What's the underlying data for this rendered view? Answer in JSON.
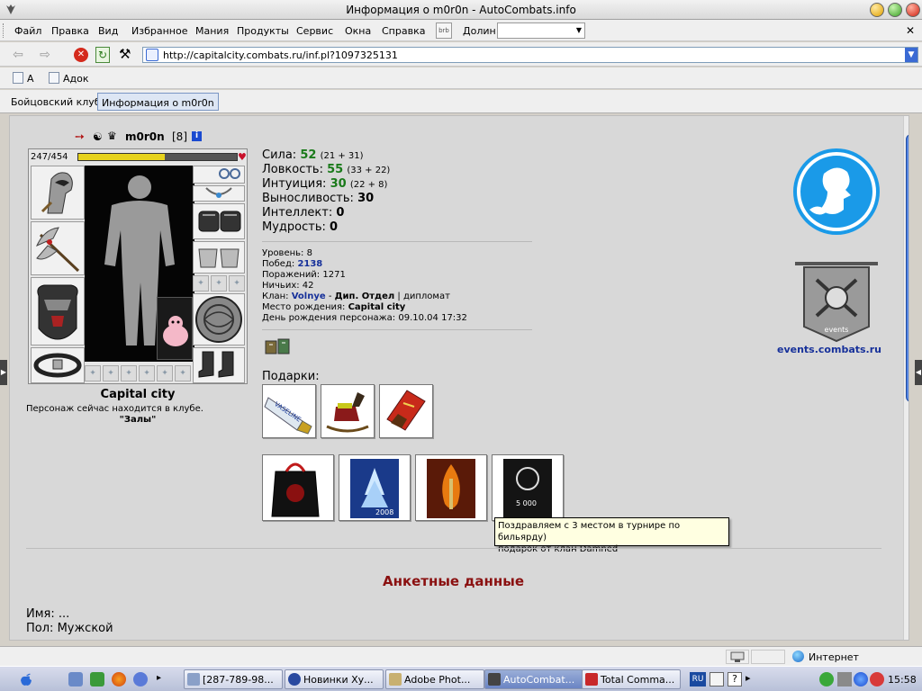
{
  "window": {
    "title": "Информация о m0r0n - AutoCombats.info"
  },
  "menu": {
    "items": [
      "Файл",
      "Правка",
      "Вид",
      "Избранное",
      "Мания",
      "Продукты",
      "Сервис",
      "Окна",
      "Справка"
    ],
    "brb": "brb",
    "dolin_label": "Долин:",
    "dolin_value": ""
  },
  "nav": {
    "url": "http://capitalcity.combats.ru/inf.pl?1097325131"
  },
  "bookmarks": [
    "А",
    "Адок"
  ],
  "tabs": [
    "Бойцовский клуб",
    "Информация о m0r0n"
  ],
  "character": {
    "nick": "m0r0n",
    "level": "[8]",
    "hp_text": "247/454",
    "hp_fraction": 0.544,
    "city": "Capital city",
    "location_text": "Персонаж сейчас находится в клубе.",
    "location_room": "\"Залы\""
  },
  "stats": [
    {
      "label": "Сила:",
      "value": "52",
      "bonus": "(21 + 31)",
      "green": true
    },
    {
      "label": "Ловкость:",
      "value": "55",
      "bonus": "(33 + 22)",
      "green": true
    },
    {
      "label": "Интуиция:",
      "value": "30",
      "bonus": "(22 + 8)",
      "green": true
    },
    {
      "label": "Выносливость:",
      "value": "30",
      "bonus": "",
      "green": false
    },
    {
      "label": "Интеллект:",
      "value": "0",
      "bonus": "",
      "green": false
    },
    {
      "label": "Мудрость:",
      "value": "0",
      "bonus": "",
      "green": false
    }
  ],
  "info": {
    "level_label": "Уровень:",
    "level": "8",
    "wins_label": "Побед:",
    "wins": "2138",
    "losses_label": "Поражений:",
    "losses": "1271",
    "draws_label": "Ничьих:",
    "draws": "42",
    "clan_label": "Клан:",
    "clan": "Volnye",
    "clan_dash": "-",
    "clan_dept": "Дип. Отдел",
    "clan_role": "| дипломат",
    "birthplace_label": "Место рождения:",
    "birthplace": "Capital city",
    "birthday_label": "День рождения персонажа:",
    "birthday": "09.10.04 17:32"
  },
  "gifts": {
    "label": "Подарки:",
    "vaseline_text": "VASELINE",
    "calendar_year": "2008",
    "prize_text": "5 000"
  },
  "tooltip": {
    "line1": "Поздравляем с 3 местом в турнире по бильярду)",
    "line2": "подарок от клан Damned"
  },
  "side": {
    "events_link": "events.combats.ru",
    "banner_text": "events"
  },
  "profile": {
    "title": "Анкетные данные",
    "name_label": "Имя:",
    "name": "...",
    "gender_label": "Пол:",
    "gender": "Мужской"
  },
  "status": {
    "zone": "Интернет"
  },
  "taskbar": {
    "tasks": [
      "[287-789-98...",
      "Новинки Ху...",
      "Adobe Phot...",
      "AutoCombat...",
      "Total Comma..."
    ],
    "lang": "RU",
    "time": "15:58"
  },
  "colors": {
    "accent": "#2a5ac8",
    "stat_green": "#1a7a1a",
    "link_blue": "#16309a",
    "heading_red": "#8a1010"
  }
}
